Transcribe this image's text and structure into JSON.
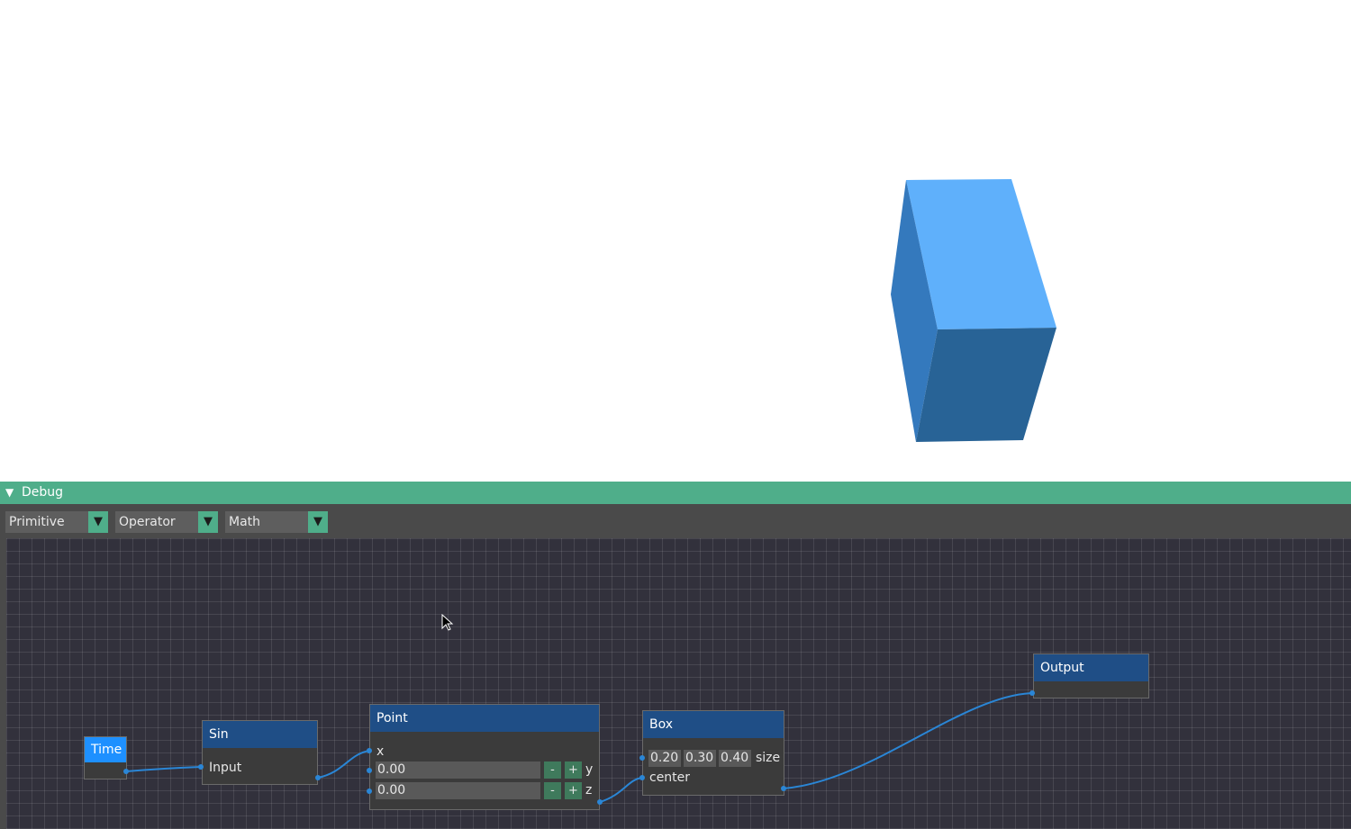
{
  "viewport": {
    "object": "box",
    "colors": {
      "top": "#5fb0fb",
      "left": "#3479bd",
      "front": "#286396"
    }
  },
  "panel": {
    "title": "Debug",
    "collapse_glyph": "▼"
  },
  "toolbar": {
    "dropdowns": [
      {
        "label": "Primitive",
        "arrow": "▼"
      },
      {
        "label": "Operator",
        "arrow": "▼"
      },
      {
        "label": "Math",
        "arrow": "▼"
      }
    ]
  },
  "nodes": {
    "time": {
      "title": "Time"
    },
    "sin": {
      "title": "Sin",
      "input_label": "Input"
    },
    "point": {
      "title": "Point",
      "x_label": "x",
      "y_label": "y",
      "z_label": "z",
      "y_value": "0.00",
      "z_value": "0.00",
      "minus": "-",
      "plus": "+"
    },
    "box": {
      "title": "Box",
      "size_values": [
        "0.20",
        "0.30",
        "0.40"
      ],
      "size_label": "size",
      "center_label": "center"
    },
    "output": {
      "title": "Output"
    }
  },
  "colors": {
    "accent": "#4fae8a",
    "node_header": "#1f4e86",
    "time_header": "#1e90ff",
    "wire": "#2a86d6",
    "graph_bg": "#32313c"
  }
}
